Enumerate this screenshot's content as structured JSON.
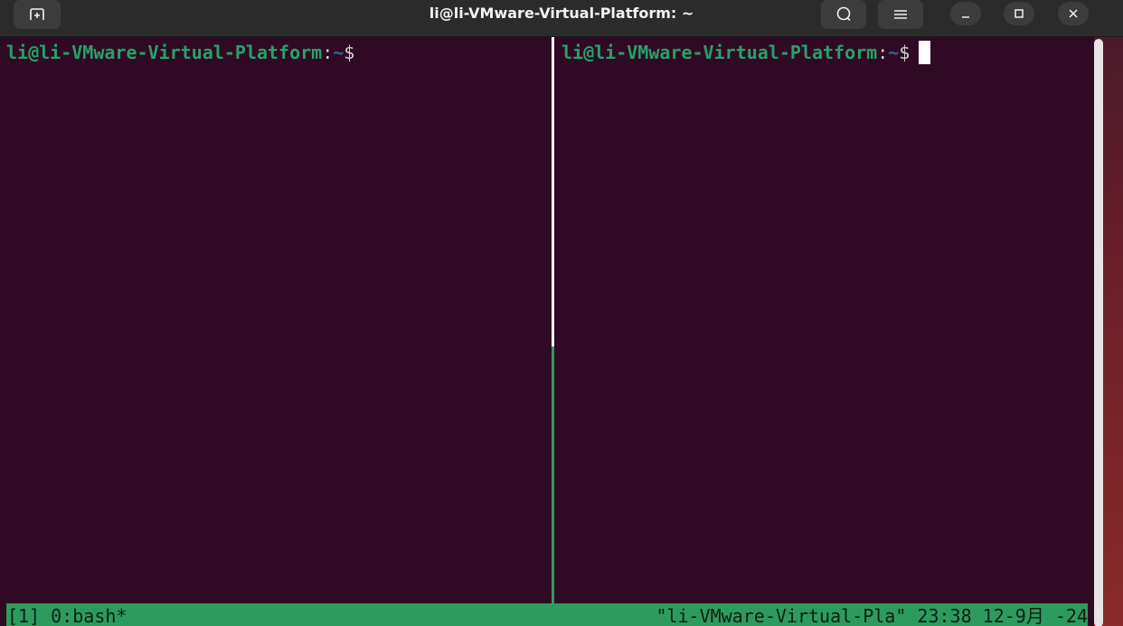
{
  "window": {
    "title": "li@li-VMware-Virtual-Platform: ~",
    "buttons": {
      "new_tab_icon": "new-tab-icon",
      "search_icon": "search-icon",
      "menu_icon": "hamburger-menu-icon",
      "minimize_icon": "minimize-icon",
      "maximize_icon": "maximize-icon",
      "close_icon": "close-icon"
    }
  },
  "panes": {
    "left": {
      "user_host": "li@li-VMware-Virtual-Platform",
      "colon": ":",
      "path": "~",
      "dollar": "$"
    },
    "right": {
      "user_host": "li@li-VMware-Virtual-Platform",
      "colon": ":",
      "path": "~",
      "dollar": "$",
      "active": true
    }
  },
  "status_bar": {
    "left": "[1] 0:bash*",
    "right": "\"li-VMware-Virtual-Pla\" 23:38 12-9月 -24"
  },
  "colors": {
    "terminal_bg": "#300a24",
    "prompt_user": "#26a269",
    "prompt_path": "#3465a4",
    "status_bar_bg": "#2e9b5e"
  }
}
